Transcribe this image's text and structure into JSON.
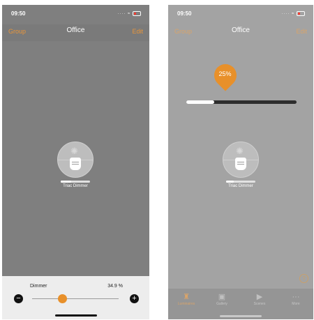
{
  "left": {
    "status": {
      "time": "09:50"
    },
    "nav": {
      "left": "Group",
      "title": "Office",
      "right": "Edit"
    },
    "luminaire": {
      "name": "Triac Dimmer",
      "level_fraction": 0.35
    },
    "dimmer": {
      "label": "Dimmer",
      "value_text": "34.9 %",
      "value": 34.9,
      "minus": "−",
      "plus": "+"
    }
  },
  "right": {
    "status": {
      "time": "09:50"
    },
    "nav": {
      "left": "Group",
      "title": "Office",
      "right": "Edit"
    },
    "slider": {
      "value_text": "25%",
      "value": 25
    },
    "luminaire": {
      "name": "Triac Dimmer",
      "level_fraction": 0.25
    },
    "help": "?",
    "tabs": [
      {
        "label": "Luminaires",
        "icon": "lamp-icon"
      },
      {
        "label": "Gallery",
        "icon": "gallery-icon"
      },
      {
        "label": "Scenes",
        "icon": "play-icon"
      },
      {
        "label": "More",
        "icon": "more-icon"
      }
    ]
  },
  "colors": {
    "accent": "#e8902a",
    "nav_accent": "#e8953a"
  }
}
